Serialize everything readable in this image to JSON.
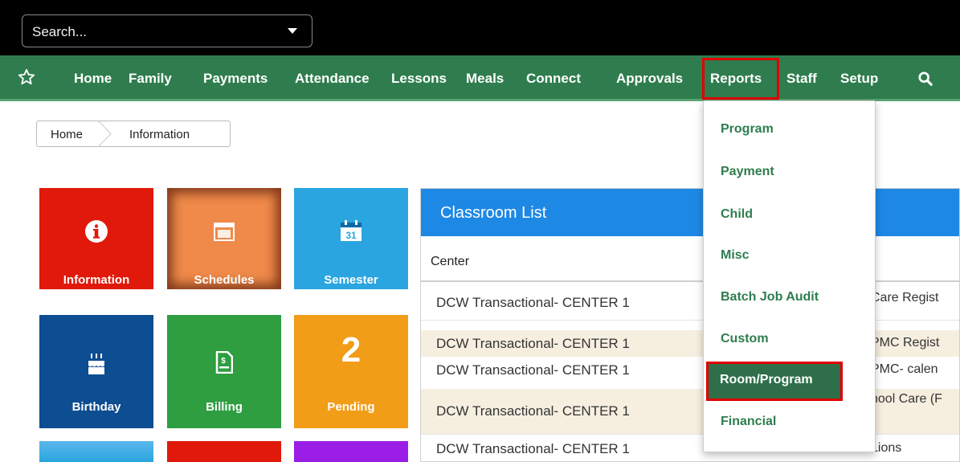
{
  "search": {
    "placeholder": "Search..."
  },
  "nav": {
    "items": [
      "Home",
      "Family",
      "Payments",
      "Attendance",
      "Lessons",
      "Meals",
      "Connect",
      "Approvals",
      "Reports",
      "Staff",
      "Setup"
    ],
    "icons": {
      "favorite": "star-icon",
      "search": "search-icon"
    }
  },
  "breadcrumb": [
    "Home",
    "Information"
  ],
  "tiles": [
    {
      "label": "Information",
      "icon": "info-icon",
      "color": "#e0190a"
    },
    {
      "label": "Schedules",
      "icon": "calendar-icon",
      "color": "#ef8a4a"
    },
    {
      "label": "Semester",
      "icon": "calendar-31-icon",
      "color": "#2aa5e0"
    },
    {
      "label": "Birthday",
      "icon": "birthday-cake-icon",
      "color": "#0d4d91"
    },
    {
      "label": "Billing",
      "icon": "invoice-icon",
      "color": "#2e9e40"
    },
    {
      "label": "Pending",
      "value": "2",
      "color": "#f29d17"
    }
  ],
  "classroom_list": {
    "title": "Classroom List",
    "column": "Center",
    "rows": [
      {
        "center": "DCW Transactional- CENTER 1",
        "classroom": "Care Regist"
      },
      {
        "center": "DCW Transactional- CENTER 1",
        "classroom": "PMC Regist"
      },
      {
        "center": "DCW Transactional- CENTER 1",
        "classroom": "PMC- calen"
      },
      {
        "center": "DCW Transactional- CENTER 1",
        "classroom": "hool Care (F"
      },
      {
        "center": "DCW Transactional- CENTER 1",
        "classroom": "Lions"
      }
    ]
  },
  "reports_menu": {
    "items": [
      "Program",
      "Payment",
      "Child",
      "Misc",
      "Batch Job Audit",
      "Custom",
      "Room/Program",
      "Financial"
    ],
    "active": "Room/Program"
  },
  "colors": {
    "nav_green": "#2f7d4e",
    "highlight_red": "#e00000",
    "header_blue": "#1e88e5"
  }
}
